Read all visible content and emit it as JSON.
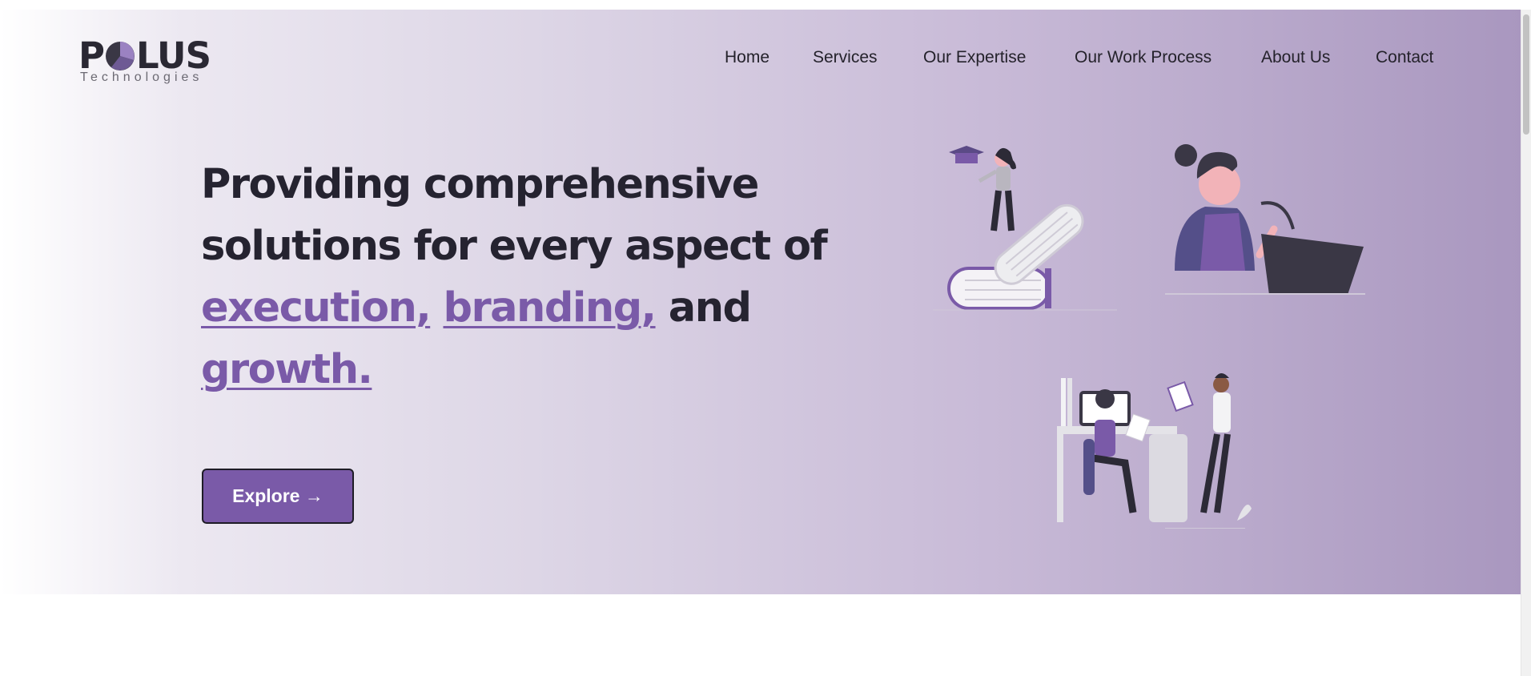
{
  "brand": {
    "logo_text_left": "P",
    "logo_text_right": "LUS",
    "logo_subtitle": "Technologies"
  },
  "nav": {
    "items": [
      "Home",
      "Services",
      "Our Expertise",
      "Our Work Process",
      "About Us",
      "Contact"
    ]
  },
  "hero": {
    "line1": "Providing comprehensive",
    "line2": "solutions for every aspect of",
    "highlight1": "execution,",
    "highlight2": "branding,",
    "and_word": "and",
    "highlight3": "growth.",
    "cta_label": "Explore →"
  },
  "colors": {
    "accent": "#7a5aa8",
    "text": "#252330",
    "hero_end": "#a997bf"
  },
  "illustrations": [
    "graduate-on-books",
    "speaker-at-podium",
    "team-at-desk"
  ]
}
